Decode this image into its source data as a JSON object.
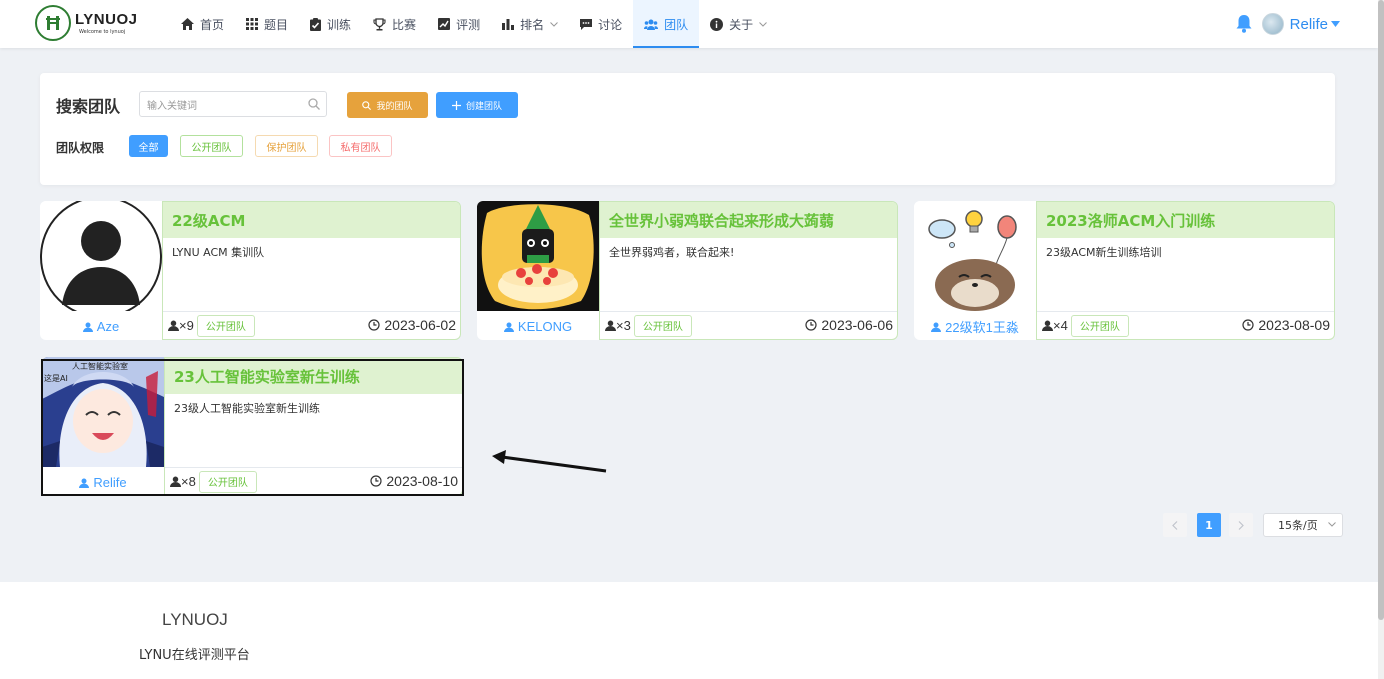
{
  "brand": {
    "name": "LYNUOJ",
    "tagline": "Welcome to lynuoj"
  },
  "nav": {
    "items": [
      {
        "label": "首页",
        "icon": "home-icon"
      },
      {
        "label": "题目",
        "icon": "grid-icon"
      },
      {
        "label": "训练",
        "icon": "clipboard-check-icon"
      },
      {
        "label": "比赛",
        "icon": "trophy-icon"
      },
      {
        "label": "评测",
        "icon": "chart-line-icon"
      },
      {
        "label": "排名",
        "icon": "bar-chart-icon"
      },
      {
        "label": "讨论",
        "icon": "comment-icon"
      },
      {
        "label": "团队",
        "icon": "users-icon",
        "active": true
      },
      {
        "label": "关于",
        "icon": "info-icon"
      }
    ],
    "user": "Relife"
  },
  "search": {
    "title": "搜索团队",
    "placeholder": "输入关键词",
    "my_teams": "我的团队",
    "create_team": "创建团队",
    "permission_label": "团队权限",
    "filters": {
      "all": "全部",
      "public": "公开团队",
      "protected": "保护团队",
      "private": "私有团队"
    }
  },
  "teams": [
    {
      "name": "22级ACM",
      "description": "LYNU ACM 集训队",
      "owner": "Aze",
      "members": "×9",
      "tag": "公开团队",
      "date": "2023-06-02"
    },
    {
      "name": "全世界小弱鸡联合起来形成大蒟蒻",
      "description": "全世界弱鸡者，联合起来!",
      "owner": "KELONG",
      "members": "×3",
      "tag": "公开团队",
      "date": "2023-06-06"
    },
    {
      "name": "2023洛师ACM入门训练",
      "description": "23级ACM新生训练培训",
      "owner": "22级软1王淼",
      "members": "×4",
      "tag": "公开团队",
      "date": "2023-08-09"
    },
    {
      "name": "23人工智能实验室新生训练",
      "description": "23级人工智能实验室新生训练",
      "owner": "Relife",
      "members": "×8",
      "tag": "公开团队",
      "date": "2023-08-10",
      "img_caption_top": "人工智能实验室",
      "img_caption_left": "这是AI"
    }
  ],
  "pagination": {
    "current": "1",
    "page_size": "15条/页"
  },
  "footer": {
    "title": "LYNUOJ",
    "subtitle": "LYNU在线评测平台"
  },
  "colors": {
    "primary": "#409eff",
    "success": "#67c23a",
    "warning": "#e6a23c",
    "danger": "#f56c6c"
  }
}
